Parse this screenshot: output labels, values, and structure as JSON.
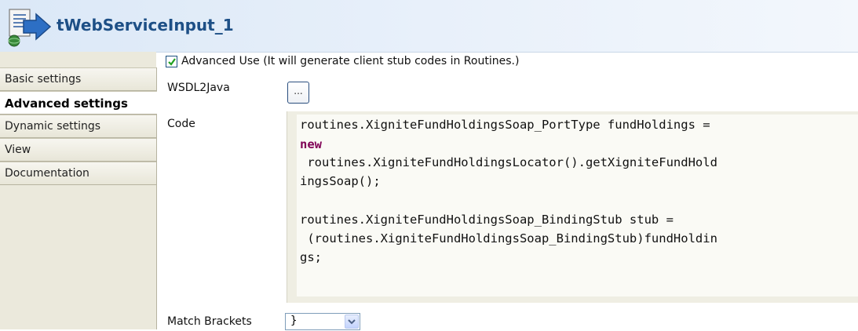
{
  "header": {
    "component_name": "tWebServiceInput_1",
    "icon": "web-service-component-icon"
  },
  "tabs": [
    {
      "label": "Basic settings",
      "active": false
    },
    {
      "label": "Advanced settings",
      "active": true
    },
    {
      "label": "Dynamic settings",
      "active": false
    },
    {
      "label": "View",
      "active": false
    },
    {
      "label": "Documentation",
      "active": false
    }
  ],
  "settings": {
    "advanced_use": {
      "checked": true,
      "label": "Advanced Use (It will generate client stub codes in Routines.)"
    },
    "wsdl2java": {
      "label": "WSDL2Java",
      "button_label": "..."
    },
    "code": {
      "label": "Code",
      "lines": [
        "routines.XigniteFundHoldingsSoap_PortType fundHoldings =",
        "new",
        " routines.XigniteFundHoldingsLocator().getXigniteFundHold",
        "ingsSoap();",
        "",
        "routines.XigniteFundHoldingsSoap_BindingStub stub =",
        " (routines.XigniteFundHoldingsSoap_BindingStub)fundHoldin",
        "gs;"
      ]
    },
    "match_brackets": {
      "label": "Match Brackets",
      "value": "}"
    }
  },
  "colors": {
    "title_text": "#1d4f86",
    "keyword": "#7f0055",
    "panel_background": "#ebe9dc"
  }
}
